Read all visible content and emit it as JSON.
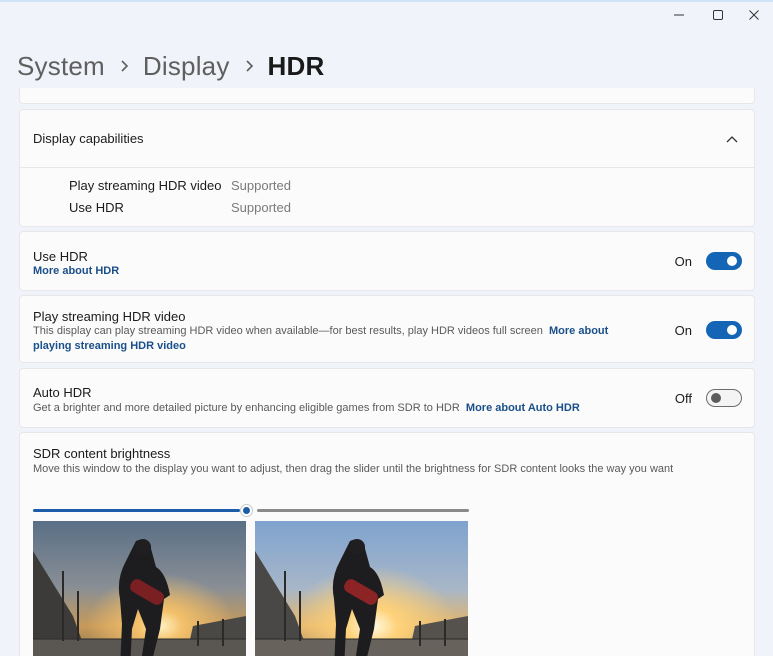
{
  "window": {
    "controls": {
      "minimize_icon": "minimize-icon",
      "maximize_icon": "maximize-icon",
      "close_icon": "close-icon"
    }
  },
  "breadcrumb": {
    "items": [
      "System",
      "Display"
    ],
    "current": "HDR",
    "separator_icon": "chevron-right-icon"
  },
  "capabilities": {
    "title": "Display capabilities",
    "chevron_icon": "chevron-up-icon",
    "rows": [
      {
        "name": "Play streaming HDR video",
        "value": "Supported"
      },
      {
        "name": "Use HDR",
        "value": "Supported"
      }
    ]
  },
  "use_hdr": {
    "title": "Use HDR",
    "link": "More about HDR",
    "state_label": "On",
    "state": true
  },
  "streaming": {
    "title": "Play streaming HDR video",
    "desc": "This display can play streaming HDR video when available—for best results, play HDR videos full screen",
    "link_part1": "More about",
    "link_part2": "playing streaming HDR video",
    "state_label": "On",
    "state": true
  },
  "auto_hdr": {
    "title": "Auto HDR",
    "desc": "Get a brighter and more detailed picture by enhancing eligible games from SDR to HDR",
    "link": "More about Auto HDR",
    "state_label": "Off",
    "state": false
  },
  "sdr": {
    "title": "SDR content brightness",
    "desc": "Move this window to the display you want to adjust, then drag the slider until the brightness for SDR content looks the way you want",
    "slider_value": 0.48
  },
  "colors": {
    "accent": "#1565b7",
    "link": "#1a4f8a",
    "background": "#f0f3f9",
    "card": "#fbfbfc"
  }
}
